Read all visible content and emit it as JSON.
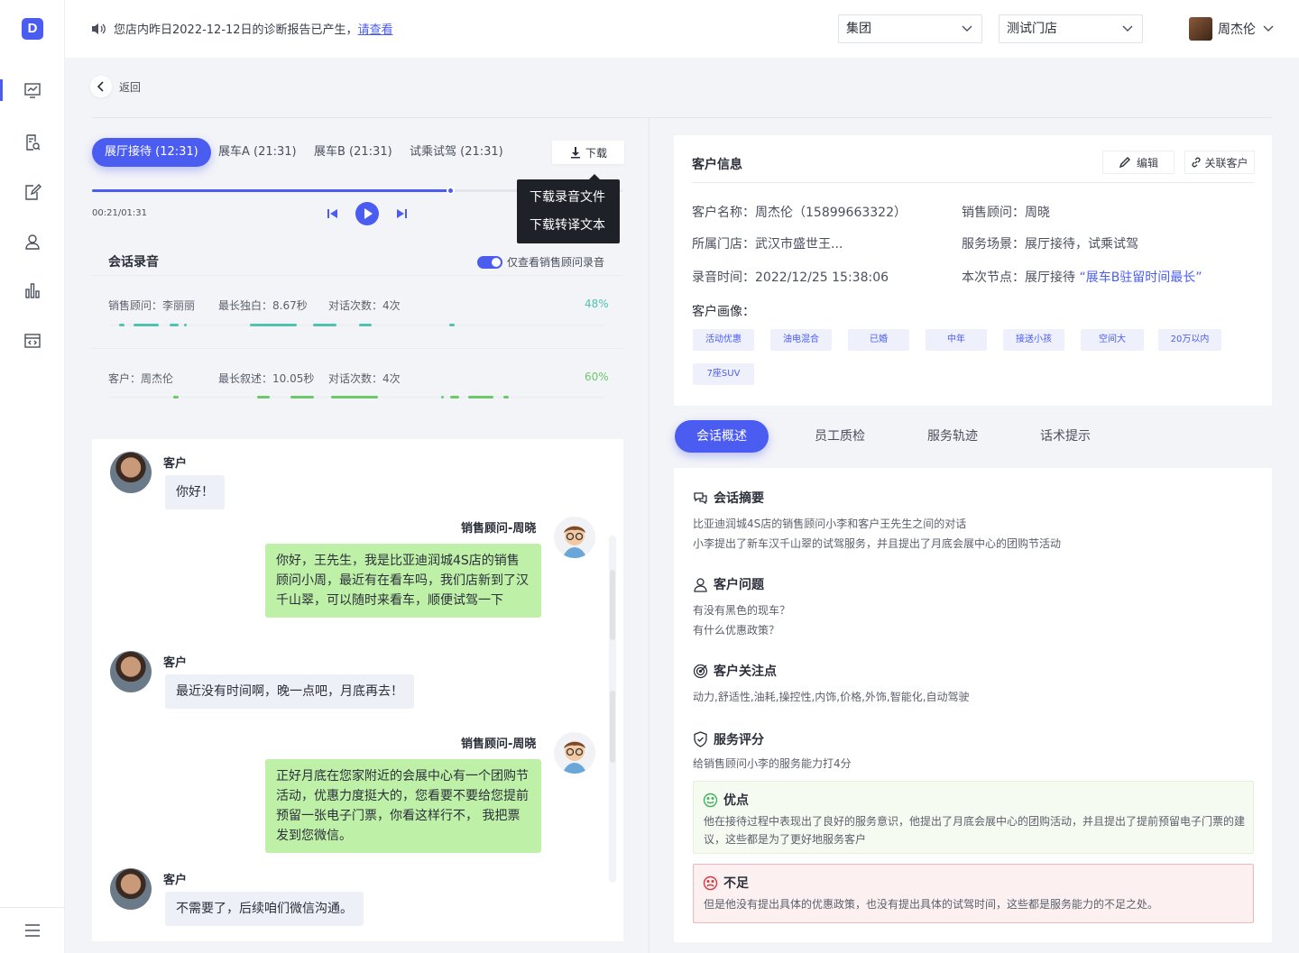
{
  "logo": {
    "letter": "D"
  },
  "notice": {
    "text": "您店内昨日2022-12-12日的诊断报告已产生，",
    "link": "请查看"
  },
  "selects": {
    "group": "集团",
    "store": "测试门店"
  },
  "user": {
    "name": "周杰伦"
  },
  "back_label": "返回",
  "audio_tabs": [
    "展厅接待 (12:31)",
    "展车A (21:31)",
    "展车B (21:31)",
    "试乘试驾 (21:31)"
  ],
  "download": {
    "label": "下载",
    "menu": [
      "下载录音文件",
      "下载转译文本"
    ]
  },
  "player": {
    "time": "00:21/01:31",
    "progress": 0.675
  },
  "recording": {
    "title": "会话录音",
    "toggle_label": "仅查看销售顾问录音",
    "advisor": {
      "name": "销售顾问：李丽丽",
      "longest": "最长独白：8.67秒",
      "turns": "对话次数：4次",
      "percent": "48%",
      "color": "#4fc3b0"
    },
    "customer": {
      "name": "客户：周杰伦",
      "longest": "最长叙述：10.05秒",
      "turns": "对话次数：4次",
      "percent": "60%",
      "color": "#6dc86a"
    }
  },
  "chat": [
    {
      "side": "left",
      "name": "客户",
      "text": "你好！"
    },
    {
      "side": "right",
      "name": "销售顾问-周晓",
      "text": "你好，王先生，我是比亚迪润城4S店的销售顾问小周，最近有在看车吗，我们店新到了汉千山翠，可以随时来看车，顺便试驾一下"
    },
    {
      "side": "left",
      "name": "客户",
      "text": "最近没有时间啊，晚一点吧，月底再去！"
    },
    {
      "side": "right",
      "name": "销售顾问-周晓",
      "text": "正好月底在您家附近的会展中心有一个团购节活动，优惠力度挺大的，您看要不要给您提前预留一张电子门票，你看这样行不， 我把票发到您微信。"
    },
    {
      "side": "left",
      "name": "客户",
      "text": "不需要了，后续咱们微信沟通。"
    }
  ],
  "customer_info": {
    "title": "客户信息",
    "edit": "编辑",
    "link": "关联客户",
    "name": "客户名称：周杰伦（15899663322）",
    "advisor": "销售顾问：周晓",
    "store": "所属门店：武汉市盛世王...",
    "scene": "服务场景：展厅接待，试乘试驾",
    "rec_time": "录音时间：2022/12/25  15:38:06",
    "node_prefix": "本次节点：展厅接待 ",
    "node_highlight": "“展车B驻留时间最长”",
    "portrait_label": "客户画像：",
    "tags": [
      "活动优惠",
      "油电混合",
      "已婚",
      "中年",
      "接送小孩",
      "空间大",
      "20万以内",
      "7座SUV"
    ]
  },
  "right_tabs": [
    "会话概述",
    "员工质检",
    "服务轨迹",
    "话术提示"
  ],
  "overview": {
    "summary_title": "会话摘要",
    "summary": [
      "比亚迪润城4S店的销售顾问小李和客户王先生之间的对话",
      "小李提出了新车汉千山翠的试驾服务，并且提出了月底会展中心的团购节活动"
    ],
    "issue_title": "客户问题",
    "issues": [
      "有没有黑色的现车？",
      "有什么优惠政策？"
    ],
    "focus_title": "客户关注点",
    "focus": "动力,舒适性,油耗,操控性,内饰,价格,外饰,智能化,自动驾驶",
    "score_title": "服务评分",
    "score": "给销售顾问小李的服务能力打4分",
    "pros_title": "优点",
    "pros": "他在接待过程中表现出了良好的服务意识，他提出了月底会展中心的团购活动，并且提出了提前预留电子门票的建议，这些都是为了更好地服务客户",
    "cons_title": "不足",
    "cons": "但是他没有提出具体的优惠政策，也没有提出具体的试驾时间，这些都是服务能力的不足之处。"
  },
  "colors": {
    "accent": "#4b5cf0",
    "pros_bg": "#f6fbf2",
    "cons_bg": "#fdf0f0"
  }
}
